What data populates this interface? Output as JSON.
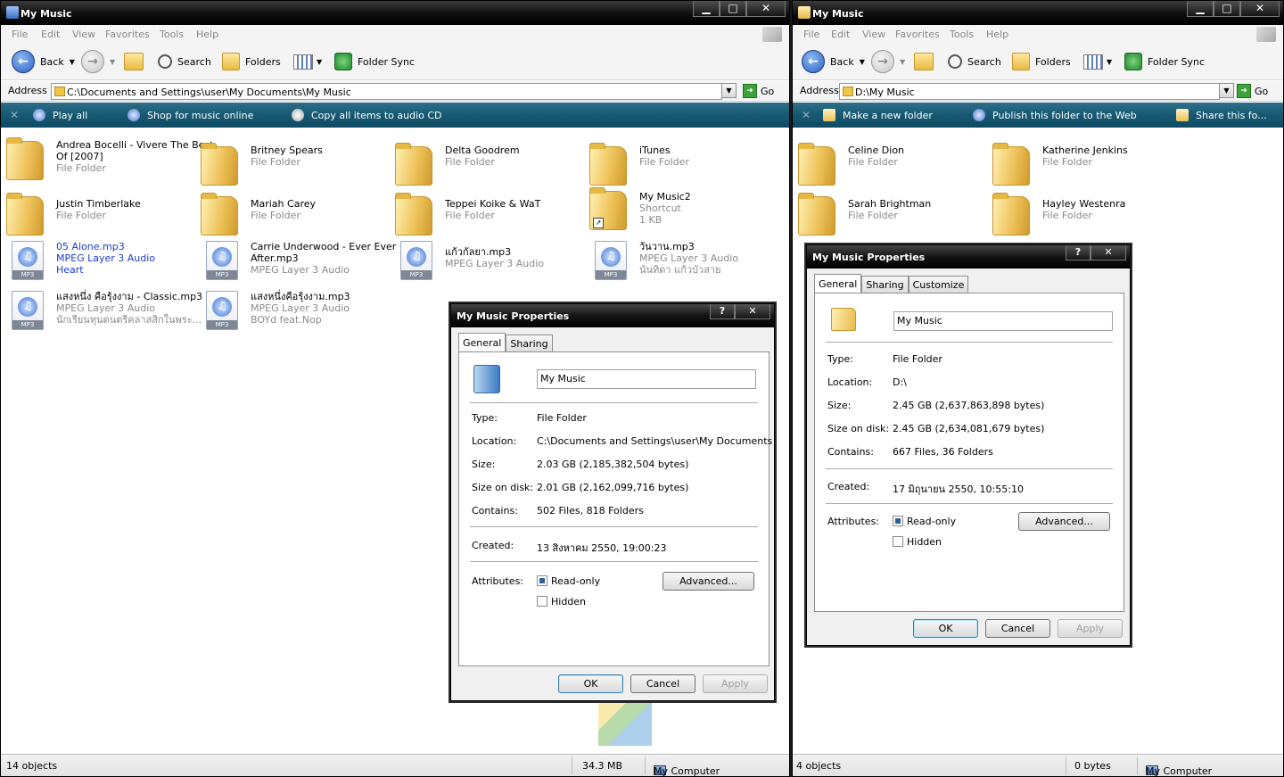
{
  "left_window": {
    "title": "My Music",
    "menu": [
      "File",
      "Edit",
      "View",
      "Favorites",
      "Tools",
      "Help"
    ],
    "toolbar": {
      "back": "Back",
      "search": "Search",
      "folders": "Folders",
      "folder_sync": "Folder Sync"
    },
    "address_label": "Address",
    "address_value": "C:\\Documents and Settings\\user\\My Documents\\My Music",
    "go_label": "Go",
    "tasks": [
      "Play all",
      "Shop for music online",
      "Copy all items to audio CD"
    ],
    "items": [
      {
        "name": "Andrea Bocelli - Vivere The Best",
        "name2": "Of [2007]",
        "type": "File Folder",
        "kind": "folder"
      },
      {
        "name": "Britney Spears",
        "type": "File Folder",
        "kind": "folder"
      },
      {
        "name": "Delta Goodrem",
        "type": "File Folder",
        "kind": "folder"
      },
      {
        "name": "iTunes",
        "type": "File Folder",
        "kind": "folder"
      },
      {
        "name": "Justin Timberlake",
        "type": "File Folder",
        "kind": "folder"
      },
      {
        "name": "Mariah Carey",
        "type": "File Folder",
        "kind": "folder"
      },
      {
        "name": "Teppei Koike & WaT",
        "type": "File Folder",
        "kind": "folder"
      },
      {
        "name": "My Music2",
        "type": "Shortcut",
        "extra": "1 KB",
        "kind": "shortcut"
      },
      {
        "name": "05 Alone.mp3",
        "type": "MPEG Layer 3 Audio",
        "extra": "Heart",
        "kind": "mp3",
        "selected": true
      },
      {
        "name": "Carrie Underwood - Ever Ever",
        "name2": "After.mp3",
        "type": "MPEG Layer 3 Audio",
        "kind": "mp3"
      },
      {
        "name": "แก้วกัลยา.mp3",
        "type": "MPEG Layer 3 Audio",
        "kind": "mp3"
      },
      {
        "name": "วันวาน.mp3",
        "type": "MPEG Layer 3 Audio",
        "extra": "นันทิดา แก้วบัวสาย",
        "kind": "mp3"
      },
      {
        "name": "แสงหนึ่ง คือรุ้งงาม - Classic.mp3",
        "type": "MPEG Layer 3 Audio",
        "extra": "นักเรียนทุนดนตรีคลาสสิกในพระ...",
        "kind": "mp3"
      },
      {
        "name": "แสงหนึ่งคือรุ้งงาม.mp3",
        "type": "MPEG Layer 3 Audio",
        "extra": "BOYd feat.Nop",
        "kind": "mp3"
      }
    ],
    "mp3_tag": "MP3",
    "status": {
      "objects": "14 objects",
      "size": "34.3 MB",
      "location": "My Computer"
    },
    "dialog": {
      "title": "My Music Properties",
      "tabs": [
        "General",
        "Sharing"
      ],
      "name": "My Music",
      "rows": [
        {
          "label": "Type:",
          "value": "File Folder"
        },
        {
          "label": "Location:",
          "value": "C:\\Documents and Settings\\user\\My Documents"
        },
        {
          "label": "Size:",
          "value": "2.03 GB (2,185,382,504 bytes)"
        },
        {
          "label": "Size on disk:",
          "value": "2.01 GB (2,162,099,716 bytes)"
        },
        {
          "label": "Contains:",
          "value": "502 Files, 818 Folders"
        }
      ],
      "created_label": "Created:",
      "created_value": "13 สิงหาคม 2550, 19:00:23",
      "attributes_label": "Attributes:",
      "readonly": "Read-only",
      "hidden": "Hidden",
      "advanced": "Advanced...",
      "ok": "OK",
      "cancel": "Cancel",
      "apply": "Apply"
    }
  },
  "right_window": {
    "title": "My Music",
    "menu": [
      "File",
      "Edit",
      "View",
      "Favorites",
      "Tools",
      "Help"
    ],
    "toolbar": {
      "back": "Back",
      "search": "Search",
      "folders": "Folders",
      "folder_sync": "Folder Sync"
    },
    "address_label": "Address",
    "address_value": "D:\\My Music",
    "go_label": "Go",
    "tasks": [
      "Make a new folder",
      "Publish this folder to the Web",
      "Share this fo..."
    ],
    "items": [
      {
        "name": "Celine Dion",
        "type": "File Folder"
      },
      {
        "name": "Katherine Jenkins",
        "type": "File Folder"
      },
      {
        "name": "Sarah Brightman",
        "type": "File Folder"
      },
      {
        "name": "Hayley Westenra",
        "type": "File Folder"
      }
    ],
    "status": {
      "objects": "4 objects",
      "size": "0 bytes",
      "location": "My Computer"
    },
    "dialog": {
      "title": "My Music Properties",
      "tabs": [
        "General",
        "Sharing",
        "Customize"
      ],
      "name": "My Music",
      "rows": [
        {
          "label": "Type:",
          "value": "File Folder"
        },
        {
          "label": "Location:",
          "value": "D:\\"
        },
        {
          "label": "Size:",
          "value": "2.45 GB (2,637,863,898 bytes)"
        },
        {
          "label": "Size on disk:",
          "value": "2.45 GB (2,634,081,679 bytes)"
        },
        {
          "label": "Contains:",
          "value": "667 Files, 36 Folders"
        }
      ],
      "created_label": "Created:",
      "created_value": "17 มิถุนายน 2550, 10:55:10",
      "attributes_label": "Attributes:",
      "readonly": "Read-only",
      "hidden": "Hidden",
      "advanced": "Advanced...",
      "ok": "OK",
      "cancel": "Cancel",
      "apply": "Apply"
    }
  },
  "caption_buttons": {
    "minimize": "▁",
    "maximize": "□",
    "close": "✕",
    "help": "?"
  }
}
